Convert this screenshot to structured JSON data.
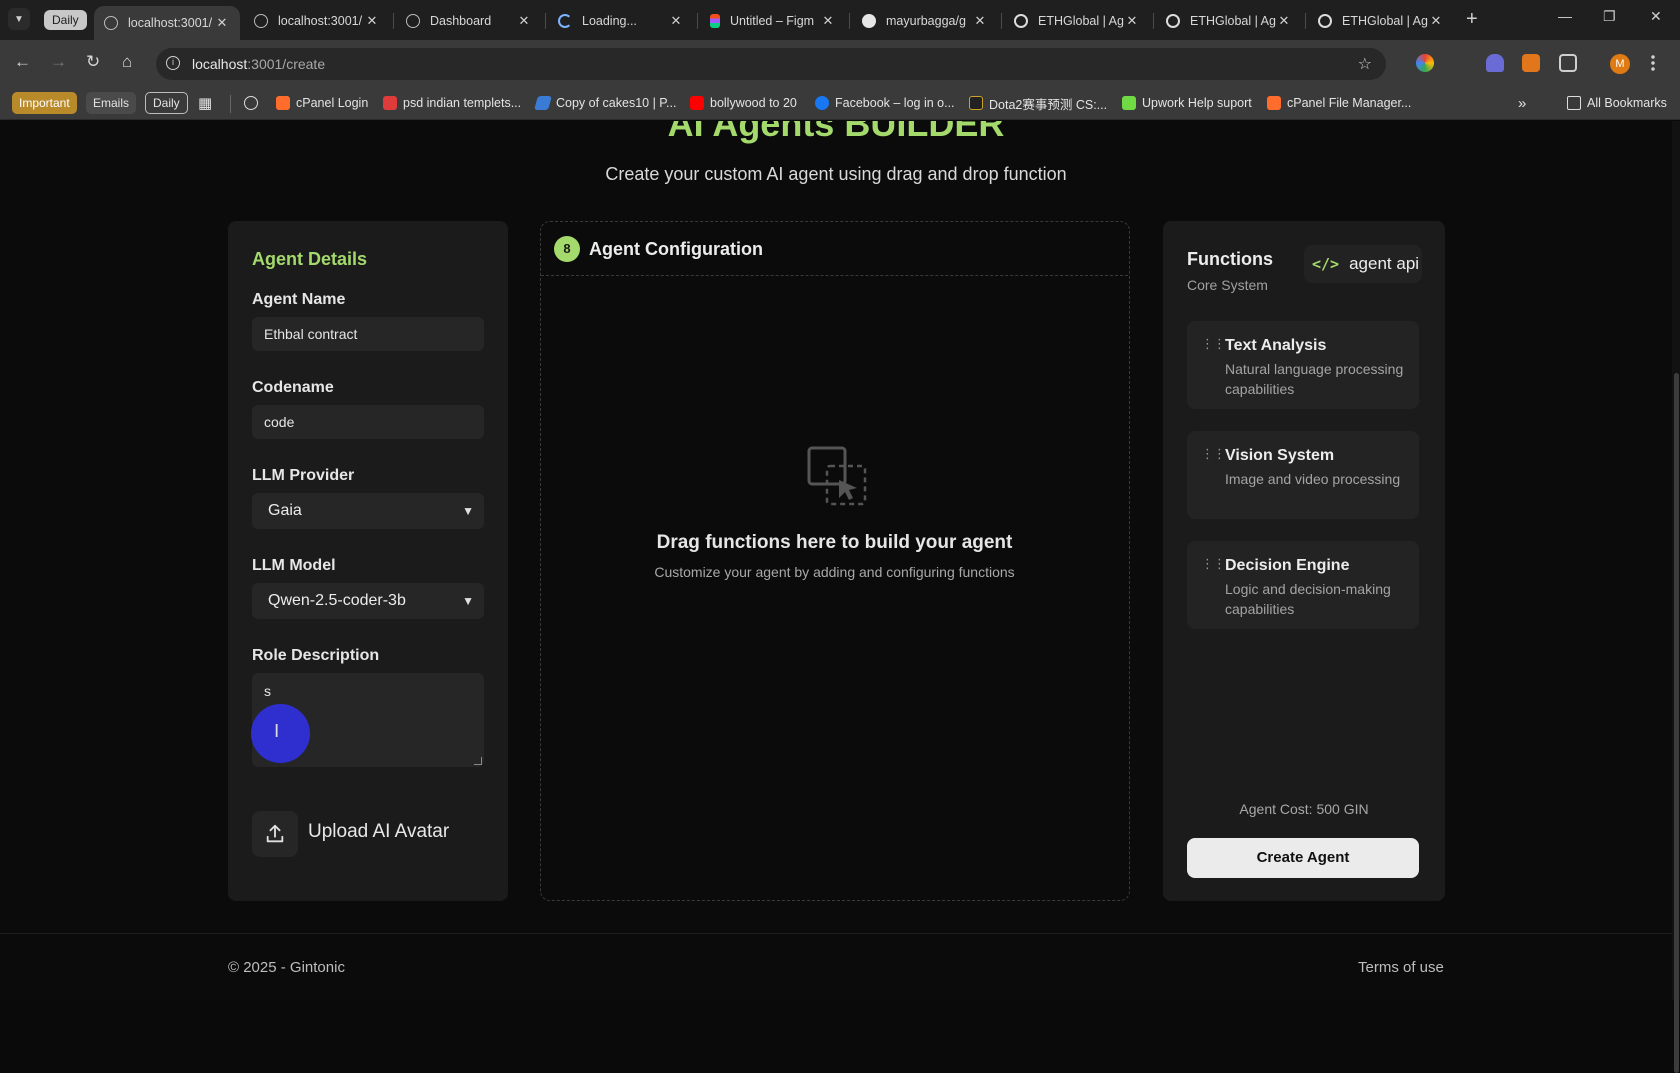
{
  "browser": {
    "tab_group_label": "Daily",
    "tabs": [
      {
        "title": "localhost:3001/",
        "active": true
      },
      {
        "title": "localhost:3001/",
        "active": false
      },
      {
        "title": "Dashboard",
        "active": false
      },
      {
        "title": "Loading...",
        "active": false
      },
      {
        "title": "Untitled – Figm",
        "active": false
      },
      {
        "title": "mayurbagga/g",
        "active": false
      },
      {
        "title": "ETHGlobal | Ag",
        "active": false
      },
      {
        "title": "ETHGlobal | Ag",
        "active": false
      },
      {
        "title": "ETHGlobal | Ag",
        "active": false
      }
    ],
    "url_host": "localhost",
    "url_path": ":3001/create",
    "bookmarks": {
      "important": "Important",
      "emails": "Emails",
      "daily": "Daily",
      "cpanel_login": "cPanel Login",
      "psd": "psd indian templets...",
      "cakes": "Copy of cakes10 | P...",
      "bollywood": "bollywood to 20",
      "facebook": "Facebook – log in o...",
      "dota": "Dota2赛事预测 CS:...",
      "upwork": "Upwork Help suport",
      "cpanel_fm": "cPanel File Manager...",
      "all_bookmarks": "All Bookmarks"
    },
    "profile_initial": "M"
  },
  "page": {
    "title": "AI Agents BUILDER",
    "subtitle": "Create your custom AI agent using drag and drop function"
  },
  "agent_details": {
    "heading": "Agent Details",
    "name_label": "Agent Name",
    "name_value": "Ethbal contract",
    "codename_label": "Codename",
    "codename_value": "code",
    "provider_label": "LLM Provider",
    "provider_value": "Gaia",
    "model_label": "LLM Model",
    "model_value": "Qwen-2.5-coder-3b",
    "role_label": "Role Description",
    "role_value": "s",
    "upload_label": "Upload AI Avatar"
  },
  "configuration": {
    "heading": "Agent Configuration",
    "drop_title": "Drag functions here to build your agent",
    "drop_subtitle": "Customize your agent by adding and configuring functions"
  },
  "functions": {
    "heading": "Functions",
    "subheading": "Core System",
    "api_button": "agent api",
    "items": [
      {
        "title": "Text Analysis",
        "description": "Natural language processing capabilities"
      },
      {
        "title": "Vision System",
        "description": "Image and video processing"
      },
      {
        "title": "Decision Engine",
        "description": "Logic and decision-making capabilities"
      }
    ],
    "cost": "Agent Cost: 500 GIN",
    "create_button": "Create Agent"
  },
  "footer": {
    "copyright": "© 2025 - Gintonic",
    "terms": "Terms of use"
  },
  "colors": {
    "accent": "#a4d96c",
    "background": "#0b0b0b",
    "panel": "#1b1b1b",
    "cursor_highlight": "#2f2fd0"
  }
}
